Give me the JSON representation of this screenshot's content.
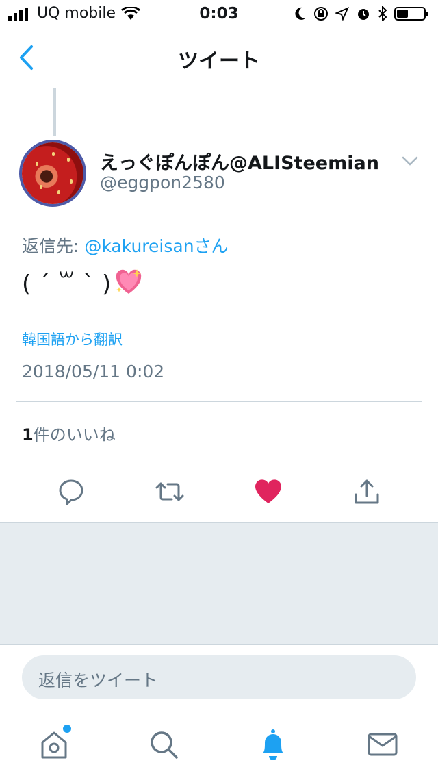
{
  "status_bar": {
    "carrier": "UQ mobile",
    "time": "0:03"
  },
  "nav": {
    "title": "ツイート"
  },
  "tweet": {
    "display_name": "えっぐぽんぽん@ALISteemian",
    "handle": "@eggpon2580",
    "reply_label": "返信先:",
    "reply_mention": "@kakureisanさん",
    "text": "( ´ ꒳ ` )",
    "emoji_icon": "sparkling-heart-icon",
    "translate_link": "韓国語から翻訳",
    "timestamp": "2018/05/11 0:02",
    "like_count": "1",
    "like_label": "件のいいね"
  },
  "actions": {
    "reply_icon": "reply-icon",
    "retweet_icon": "retweet-icon",
    "like_icon": "like-heart-icon",
    "share_icon": "share-icon"
  },
  "reply_box": {
    "placeholder": "返信をツイート"
  },
  "tab_bar": {
    "home_icon": "home-icon",
    "search_icon": "search-icon",
    "notifications_icon": "notifications-bell-icon",
    "messages_icon": "messages-icon"
  },
  "colors": {
    "accent": "#1da1f2",
    "like": "#e0245e",
    "muted": "#657786",
    "background_gray": "#e6ecf0"
  }
}
